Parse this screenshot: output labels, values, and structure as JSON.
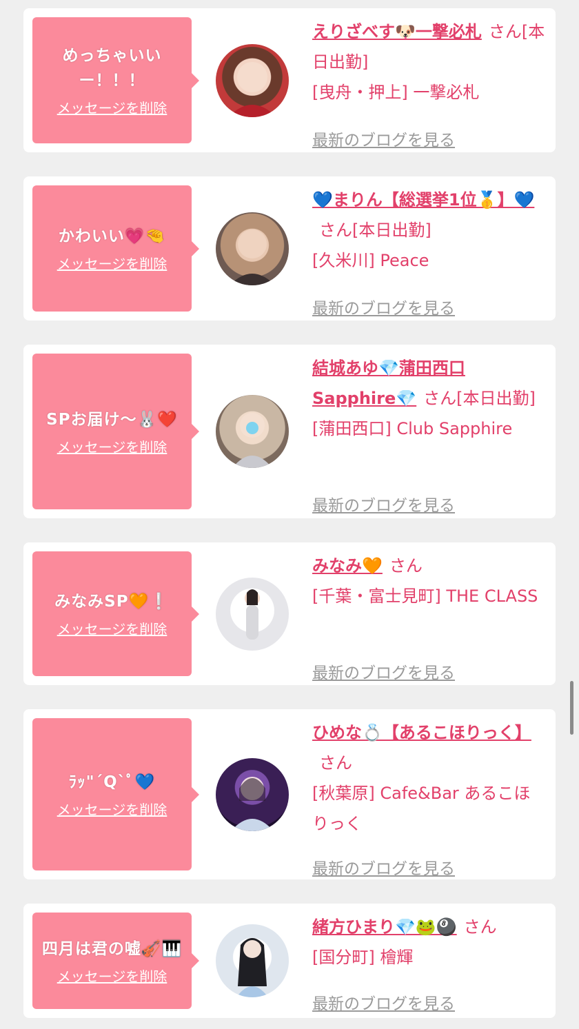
{
  "delete_label": "メッセージを削除",
  "blog_label": "最新のブログを見る",
  "san_label": "さん",
  "entries": [
    {
      "message": "めっちゃいいー！！！",
      "name": "えりざべす🐶一撃必札",
      "suffix": "[本日出勤]",
      "location": "[曳舟・押上] 一撃必札"
    },
    {
      "message": "かわいい💗🤏",
      "name": "💙まりん【総選挙1位🥇】💙",
      "suffix": "[本日出勤]",
      "location": "[久米川] Peace"
    },
    {
      "message": "SPお届け〜🐰❤️",
      "name": "結城あゆ💎蒲田西口Sapphire💎",
      "suffix": "[本日出勤]",
      "location": "[蒲田西口] Club Sapphire"
    },
    {
      "message": "みなみSP🧡❕",
      "name": "みなみ🧡",
      "suffix": "",
      "location": "[千葉・富士見町] THE CLASS"
    },
    {
      "message": "ﾗｯ\"´Q`ﾟ💙",
      "name": "ひめな💍【あるこほりっく】",
      "suffix": "",
      "location": "[秋葉原] Cafe&Bar あるこほりっく"
    },
    {
      "message": "四月は君の嘘🎻🎹",
      "name": "緒方ひまり💎🐸🎱",
      "suffix": "",
      "location": "[国分町] 檜輝"
    }
  ]
}
